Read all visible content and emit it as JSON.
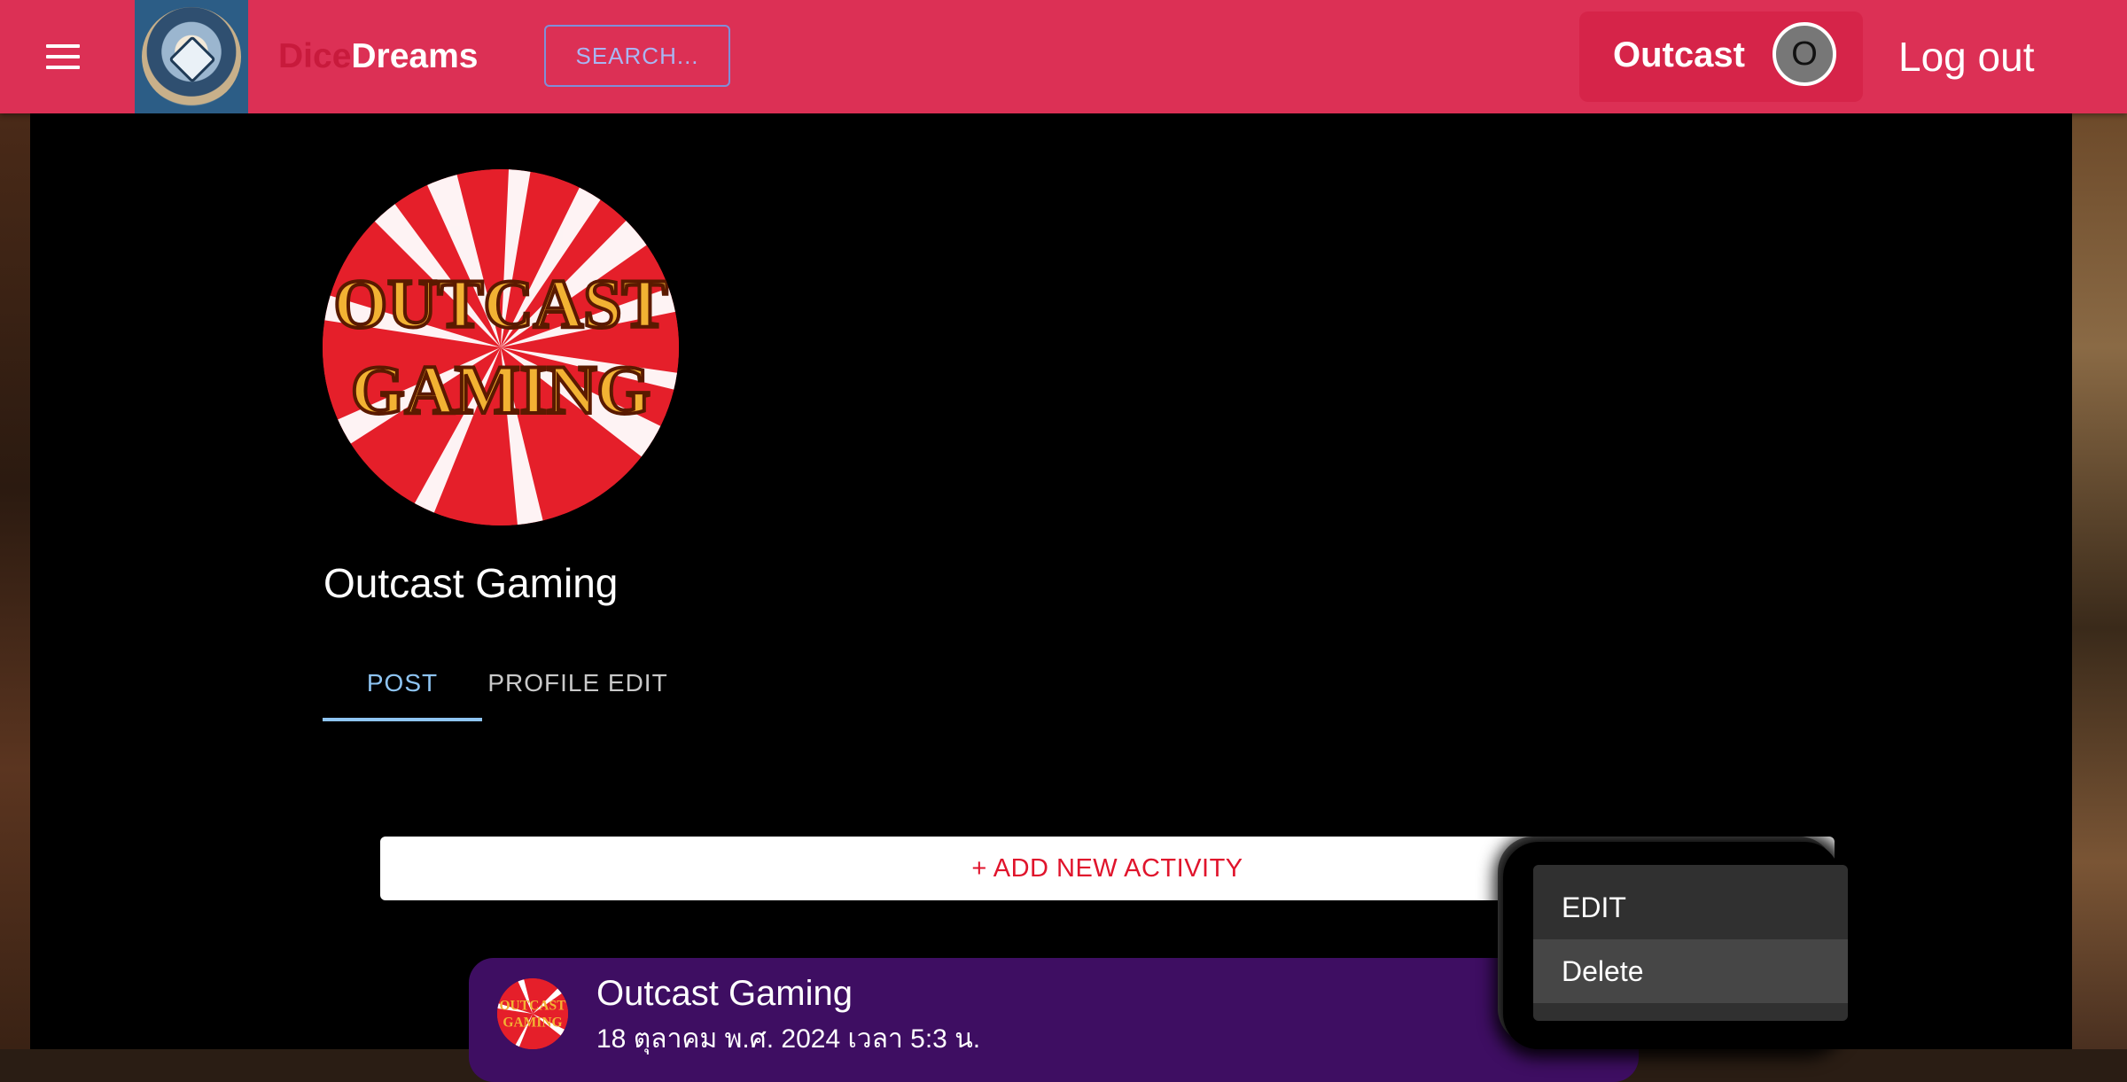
{
  "header": {
    "brand_part1": "Dice",
    "brand_part2": "Dreams",
    "search_label": "SEARCH...",
    "user_name": "Outcast",
    "avatar_initial": "O",
    "logout_label": "Log out",
    "colors": {
      "bar": "#dc3055",
      "brand_accent": "#c81a3c"
    }
  },
  "profile": {
    "logo_text_line1": "OUTCAST",
    "logo_text_line2": "GAMING",
    "name": "Outcast Gaming"
  },
  "tabs": [
    {
      "label": "POST",
      "active": true
    },
    {
      "label": "PROFILE EDIT",
      "active": false
    }
  ],
  "add_activity_label": "+ ADD NEW ACTIVITY",
  "post": {
    "author": "Outcast Gaming",
    "date": "18 ตุลาคม พ.ศ. 2024 เวลา 5:3 น."
  },
  "context_menu": {
    "items": [
      {
        "label": "EDIT"
      },
      {
        "label": "Delete"
      }
    ]
  }
}
